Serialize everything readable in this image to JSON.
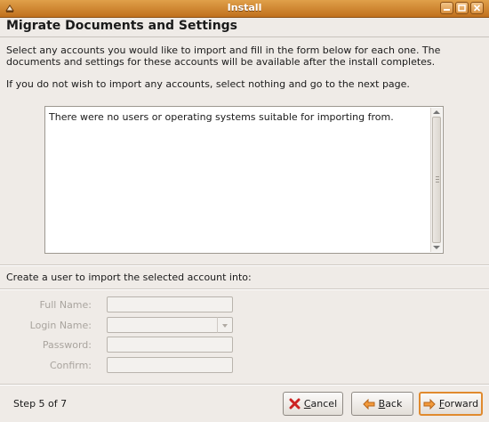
{
  "window": {
    "title": "Install"
  },
  "header": {
    "title": "Migrate Documents and Settings"
  },
  "description": {
    "line1": "Select any accounts you would like to import and fill in the form below for each one.  The",
    "line2": "documents and settings for these accounts will be available after the install completes.",
    "line3": "If you do not wish to import any accounts, select nothing and go to the next page."
  },
  "accounts_view": {
    "message": "There were no users or operating systems suitable for importing from."
  },
  "form": {
    "heading": "Create a user to import the selected account into:",
    "full_name_label": "Full Name:",
    "login_name_label": "Login Name:",
    "password_label": "Password:",
    "confirm_label": "Confirm:"
  },
  "footer": {
    "step": "Step 5 of 7",
    "cancel_first": "C",
    "cancel_rest": "ancel",
    "back_first": "B",
    "back_rest": "ack",
    "forward_first": "F",
    "forward_rest": "orward"
  },
  "colors": {
    "titlebar": "#c0701d",
    "accent": "#e08a2e",
    "cancel_icon": "#cc2222"
  },
  "icons": [
    "app-icon",
    "minimize-icon",
    "maximize-icon",
    "close-icon",
    "cancel-icon",
    "back-arrow-icon",
    "forward-arrow-icon"
  ]
}
